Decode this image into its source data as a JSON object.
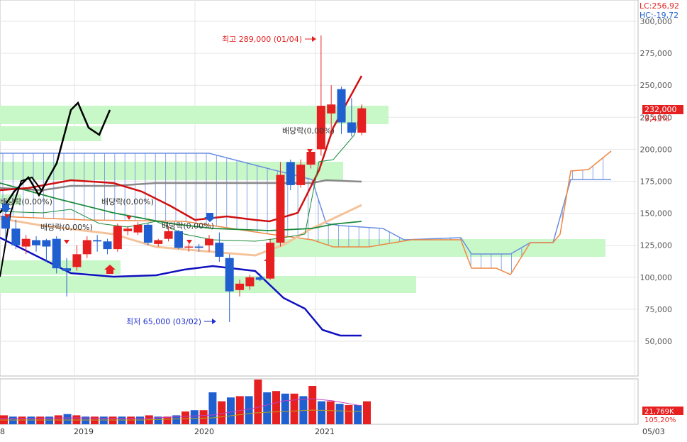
{
  "chart_data": [
    {
      "type": "candlestick",
      "period": "monthly",
      "price_axis": {
        "ticks": [
          "300,000",
          "275,000",
          "250,000",
          "225,000",
          "200,000",
          "175,000",
          "150,000",
          "125,000",
          "100,000",
          "75,000",
          "50,000"
        ],
        "range": [
          25000,
          305000
        ]
      },
      "time_axis": {
        "labels": [
          "8",
          "2019",
          "2020",
          "2021",
          "05/03"
        ]
      },
      "legend": {
        "lc": "LC:256,92",
        "hc": "HC:-19,72"
      },
      "current_price": {
        "value": 232000,
        "label": "232,000",
        "pct": "9,43%"
      },
      "annotations": {
        "high": {
          "text": "최고 289,000 (01/04)",
          "value": 289000
        },
        "low": {
          "text": "최저 65,000 (03/02)",
          "value": 65000
        },
        "dividends": [
          "배당락(0,00%)",
          "배당락(0,00%)",
          "배당락(0,00%)",
          "배당락(0,00%)",
          "배당락(0,00%)"
        ]
      },
      "candles": [
        {
          "o": 148000,
          "h": 160000,
          "l": 128000,
          "c": 138000
        },
        {
          "o": 138000,
          "h": 145000,
          "l": 122000,
          "c": 125000
        },
        {
          "o": 124000,
          "h": 133000,
          "l": 118000,
          "c": 130000
        },
        {
          "o": 129000,
          "h": 132000,
          "l": 120000,
          "c": 125000
        },
        {
          "o": 129000,
          "h": 130000,
          "l": 112000,
          "c": 124000
        },
        {
          "o": 130000,
          "h": 132000,
          "l": 103000,
          "c": 107000
        },
        {
          "o": 107000,
          "h": 115000,
          "l": 85000,
          "c": 105000
        },
        {
          "o": 108000,
          "h": 125000,
          "l": 105000,
          "c": 118000
        },
        {
          "o": 118000,
          "h": 132000,
          "l": 115000,
          "c": 129000
        },
        {
          "o": 129000,
          "h": 133000,
          "l": 120000,
          "c": 128000
        },
        {
          "o": 128000,
          "h": 130000,
          "l": 118000,
          "c": 122000
        },
        {
          "o": 122000,
          "h": 142000,
          "l": 120000,
          "c": 140000
        },
        {
          "o": 136000,
          "h": 140000,
          "l": 133000,
          "c": 138000
        },
        {
          "o": 135000,
          "h": 143000,
          "l": 133000,
          "c": 141000
        },
        {
          "o": 141000,
          "h": 142000,
          "l": 125000,
          "c": 127000
        },
        {
          "o": 126000,
          "h": 130000,
          "l": 124000,
          "c": 129000
        },
        {
          "o": 130000,
          "h": 140000,
          "l": 128000,
          "c": 136000
        },
        {
          "o": 136000,
          "h": 137000,
          "l": 122000,
          "c": 123000
        },
        {
          "o": 124000,
          "h": 126000,
          "l": 120000,
          "c": 124000
        },
        {
          "o": 124000,
          "h": 126000,
          "l": 120000,
          "c": 123000
        },
        {
          "o": 125000,
          "h": 133000,
          "l": 120000,
          "c": 130000
        },
        {
          "o": 127000,
          "h": 135000,
          "l": 112000,
          "c": 116000
        },
        {
          "o": 115000,
          "h": 118000,
          "l": 65000,
          "c": 89000
        },
        {
          "o": 90000,
          "h": 98000,
          "l": 85000,
          "c": 95000
        },
        {
          "o": 93000,
          "h": 102000,
          "l": 90000,
          "c": 100000
        },
        {
          "o": 100000,
          "h": 103000,
          "l": 97000,
          "c": 98000
        },
        {
          "o": 99000,
          "h": 130000,
          "l": 98000,
          "c": 127000
        },
        {
          "o": 127000,
          "h": 190000,
          "l": 124000,
          "c": 180000
        },
        {
          "o": 190000,
          "h": 192000,
          "l": 168000,
          "c": 172000
        },
        {
          "o": 172000,
          "h": 192000,
          "l": 170000,
          "c": 188000
        },
        {
          "o": 188000,
          "h": 200000,
          "l": 185000,
          "c": 198000
        },
        {
          "o": 200000,
          "h": 289000,
          "l": 195000,
          "c": 234000
        },
        {
          "o": 228000,
          "h": 250000,
          "l": 210000,
          "c": 235000
        },
        {
          "o": 247000,
          "h": 249000,
          "l": 212000,
          "c": 221000
        },
        {
          "o": 221000,
          "h": 240000,
          "l": 210000,
          "c": 213000
        },
        {
          "o": 213000,
          "h": 235000,
          "l": 211000,
          "c": 232000
        }
      ],
      "volume": {
        "current_label": "21,769K",
        "pct": "105,20%",
        "values": [
          7,
          6,
          6,
          6,
          6,
          6,
          7,
          8,
          7,
          6,
          6,
          6,
          6,
          6,
          6,
          6,
          7,
          6,
          6,
          7,
          10,
          11,
          11,
          25,
          18,
          21,
          22,
          22,
          35,
          25,
          26,
          24,
          24,
          22,
          30,
          18,
          18,
          16,
          15,
          15,
          18
        ]
      }
    }
  ],
  "colors": {
    "up": "#e62020",
    "down": "#1f5fd0",
    "cloud_span": "#6a8fe0",
    "kijun": "#ee8844",
    "green_band": "#c8f7c8"
  }
}
